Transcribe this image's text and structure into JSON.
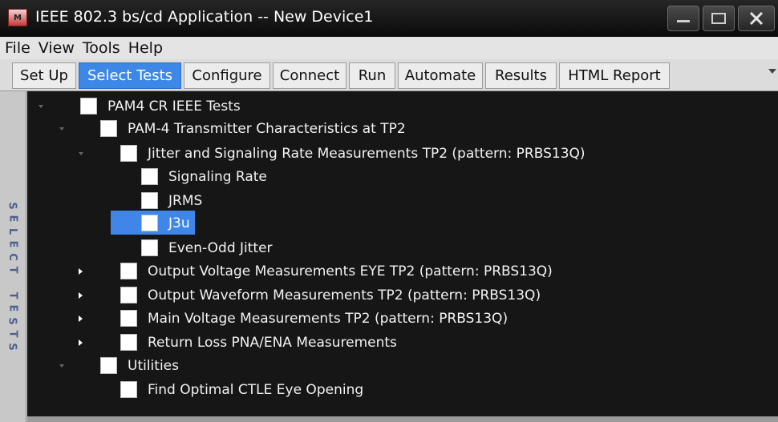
{
  "window": {
    "title": "IEEE 802.3 bs/cd Application -- New Device1",
    "icon_glyph": "M"
  },
  "menu": [
    "File",
    "View",
    "Tools",
    "Help"
  ],
  "tabs": [
    {
      "label": "Set Up",
      "active": false
    },
    {
      "label": "Select Tests",
      "active": true
    },
    {
      "label": "Configure",
      "active": false
    },
    {
      "label": "Connect",
      "active": false
    },
    {
      "label": "Run",
      "active": false
    },
    {
      "label": "Automate",
      "active": false
    },
    {
      "label": "Results",
      "active": false
    },
    {
      "label": "HTML Report",
      "active": false
    }
  ],
  "side_label": [
    "S",
    "E",
    "L",
    "E",
    "C",
    "T",
    "",
    "T",
    "E",
    "S",
    "T",
    "S"
  ],
  "tree": [
    {
      "label": "PAM4 CR IEEE Tests",
      "expanded": true,
      "level": 0,
      "checked": false
    },
    {
      "label": "PAM-4 Transmitter Characteristics at TP2",
      "expanded": true,
      "level": 1,
      "checked": false
    },
    {
      "label": "Jitter and Signaling Rate Measurements TP2 (pattern: PRBS13Q)",
      "expanded": true,
      "level": 2,
      "checked": false
    },
    {
      "label": "Signaling Rate",
      "level": 3,
      "checked": false
    },
    {
      "label": "JRMS",
      "level": 3,
      "checked": false
    },
    {
      "label": "J3u",
      "level": 3,
      "checked": false,
      "selected": true
    },
    {
      "label": "Even-Odd Jitter",
      "level": 3,
      "checked": false
    },
    {
      "label": "Output Voltage Measurements EYE TP2 (pattern: PRBS13Q)",
      "expanded": false,
      "level": 2,
      "checked": false
    },
    {
      "label": "Output Waveform Measurements TP2 (pattern: PRBS13Q)",
      "expanded": false,
      "level": 2,
      "checked": false
    },
    {
      "label": "Main Voltage Measurements TP2 (pattern: PRBS13Q)",
      "expanded": false,
      "level": 2,
      "checked": false
    },
    {
      "label": "Return Loss PNA/ENA Measurements",
      "expanded": false,
      "level": 2,
      "checked": false
    },
    {
      "label": "Utilities",
      "expanded": true,
      "level": 1,
      "checked": false
    },
    {
      "label": "Find Optimal CTLE Eye Opening",
      "level": 2,
      "checked": false
    }
  ],
  "colors": {
    "selection": "#3f86e8",
    "tree_bg": "#161616",
    "title_bg": "#111111",
    "side_label": "#4a5f8c"
  },
  "icons": {
    "minimize": "minimize-icon",
    "maximize": "maximize-icon",
    "close": "close-icon",
    "expanded": "expanded-arrow-icon",
    "collapsed": "collapsed-arrow-icon"
  }
}
